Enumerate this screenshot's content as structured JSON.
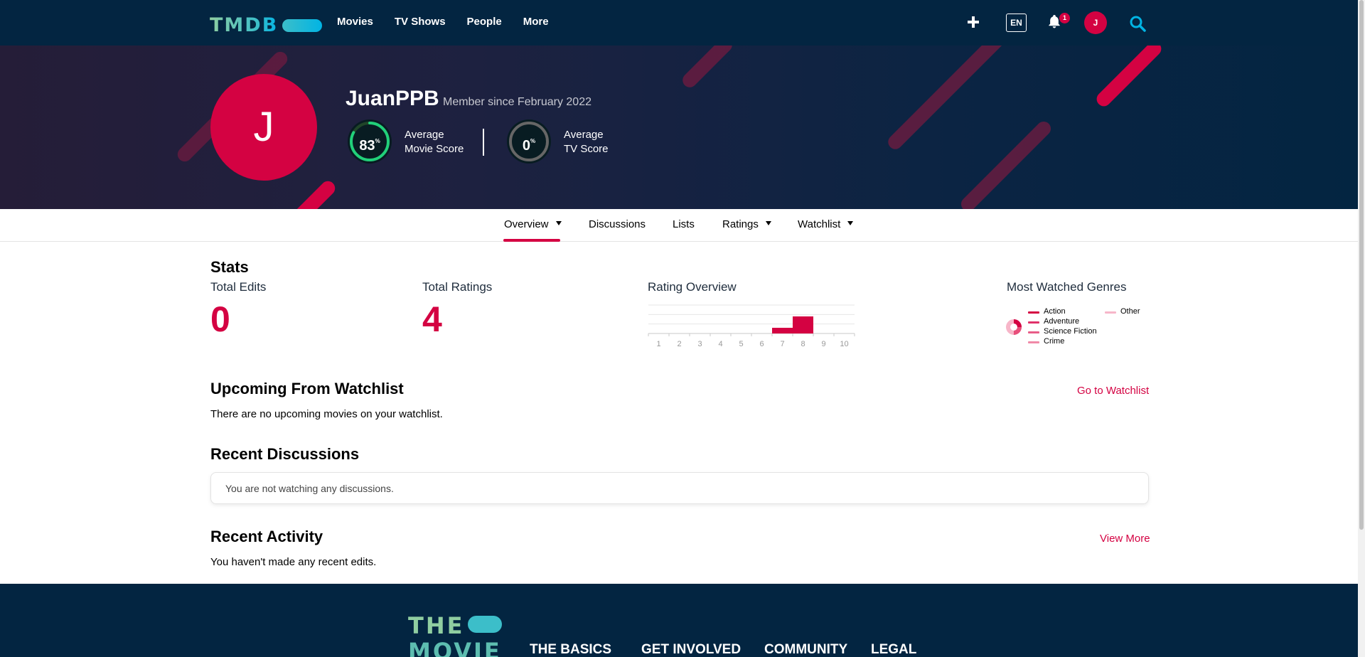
{
  "nav": {
    "logo": "TMDB",
    "links": [
      "Movies",
      "TV Shows",
      "People",
      "More"
    ],
    "language": "EN",
    "notification_count": "1",
    "avatar_initial": "J"
  },
  "profile": {
    "initial": "J",
    "username": "JuanPPB",
    "member_since": "Member since February 2022",
    "movie_score": {
      "value": "83",
      "unit": "%",
      "percent": 83,
      "label_line1": "Average",
      "label_line2": "Movie Score"
    },
    "tv_score": {
      "value": "0",
      "unit": "%",
      "percent": 0,
      "label_line1": "Average",
      "label_line2": "TV Score"
    }
  },
  "tabs": [
    "Overview",
    "Discussions",
    "Lists",
    "Ratings",
    "Watchlist"
  ],
  "stats": {
    "heading": "Stats",
    "total_edits_label": "Total Edits",
    "total_edits": "0",
    "total_ratings_label": "Total Ratings",
    "total_ratings": "4",
    "rating_overview_label": "Rating Overview",
    "genres_label": "Most Watched Genres",
    "genres": [
      "Action",
      "Adventure",
      "Science Fiction",
      "Crime",
      "Other"
    ]
  },
  "chart_data": {
    "type": "bar",
    "categories": [
      "1",
      "2",
      "3",
      "4",
      "5",
      "6",
      "7",
      "8",
      "9",
      "10"
    ],
    "values": [
      0,
      0,
      0,
      0,
      0,
      0,
      1,
      3,
      0,
      0
    ],
    "title": "Rating Overview",
    "xlabel": "",
    "ylabel": "",
    "grid": true,
    "bar_color": "#d40242"
  },
  "watchlist": {
    "heading": "Upcoming From Watchlist",
    "link": "Go to Watchlist",
    "empty_text": "There are no upcoming movies on your watchlist."
  },
  "discussions": {
    "heading": "Recent Discussions",
    "empty_text": "You are not watching any discussions."
  },
  "activity": {
    "heading": "Recent Activity",
    "link": "View More",
    "empty_text": "You haven't made any recent edits."
  },
  "footer": {
    "logo_line1": "THE",
    "logo_line2": "MOVIE",
    "headings": [
      "THE BASICS",
      "GET INVOLVED",
      "COMMUNITY",
      "LEGAL"
    ]
  },
  "colors": {
    "brand_dark": "#032541",
    "accent": "#d40242",
    "score_green": "#21d07a",
    "score_gray": "#666666"
  }
}
